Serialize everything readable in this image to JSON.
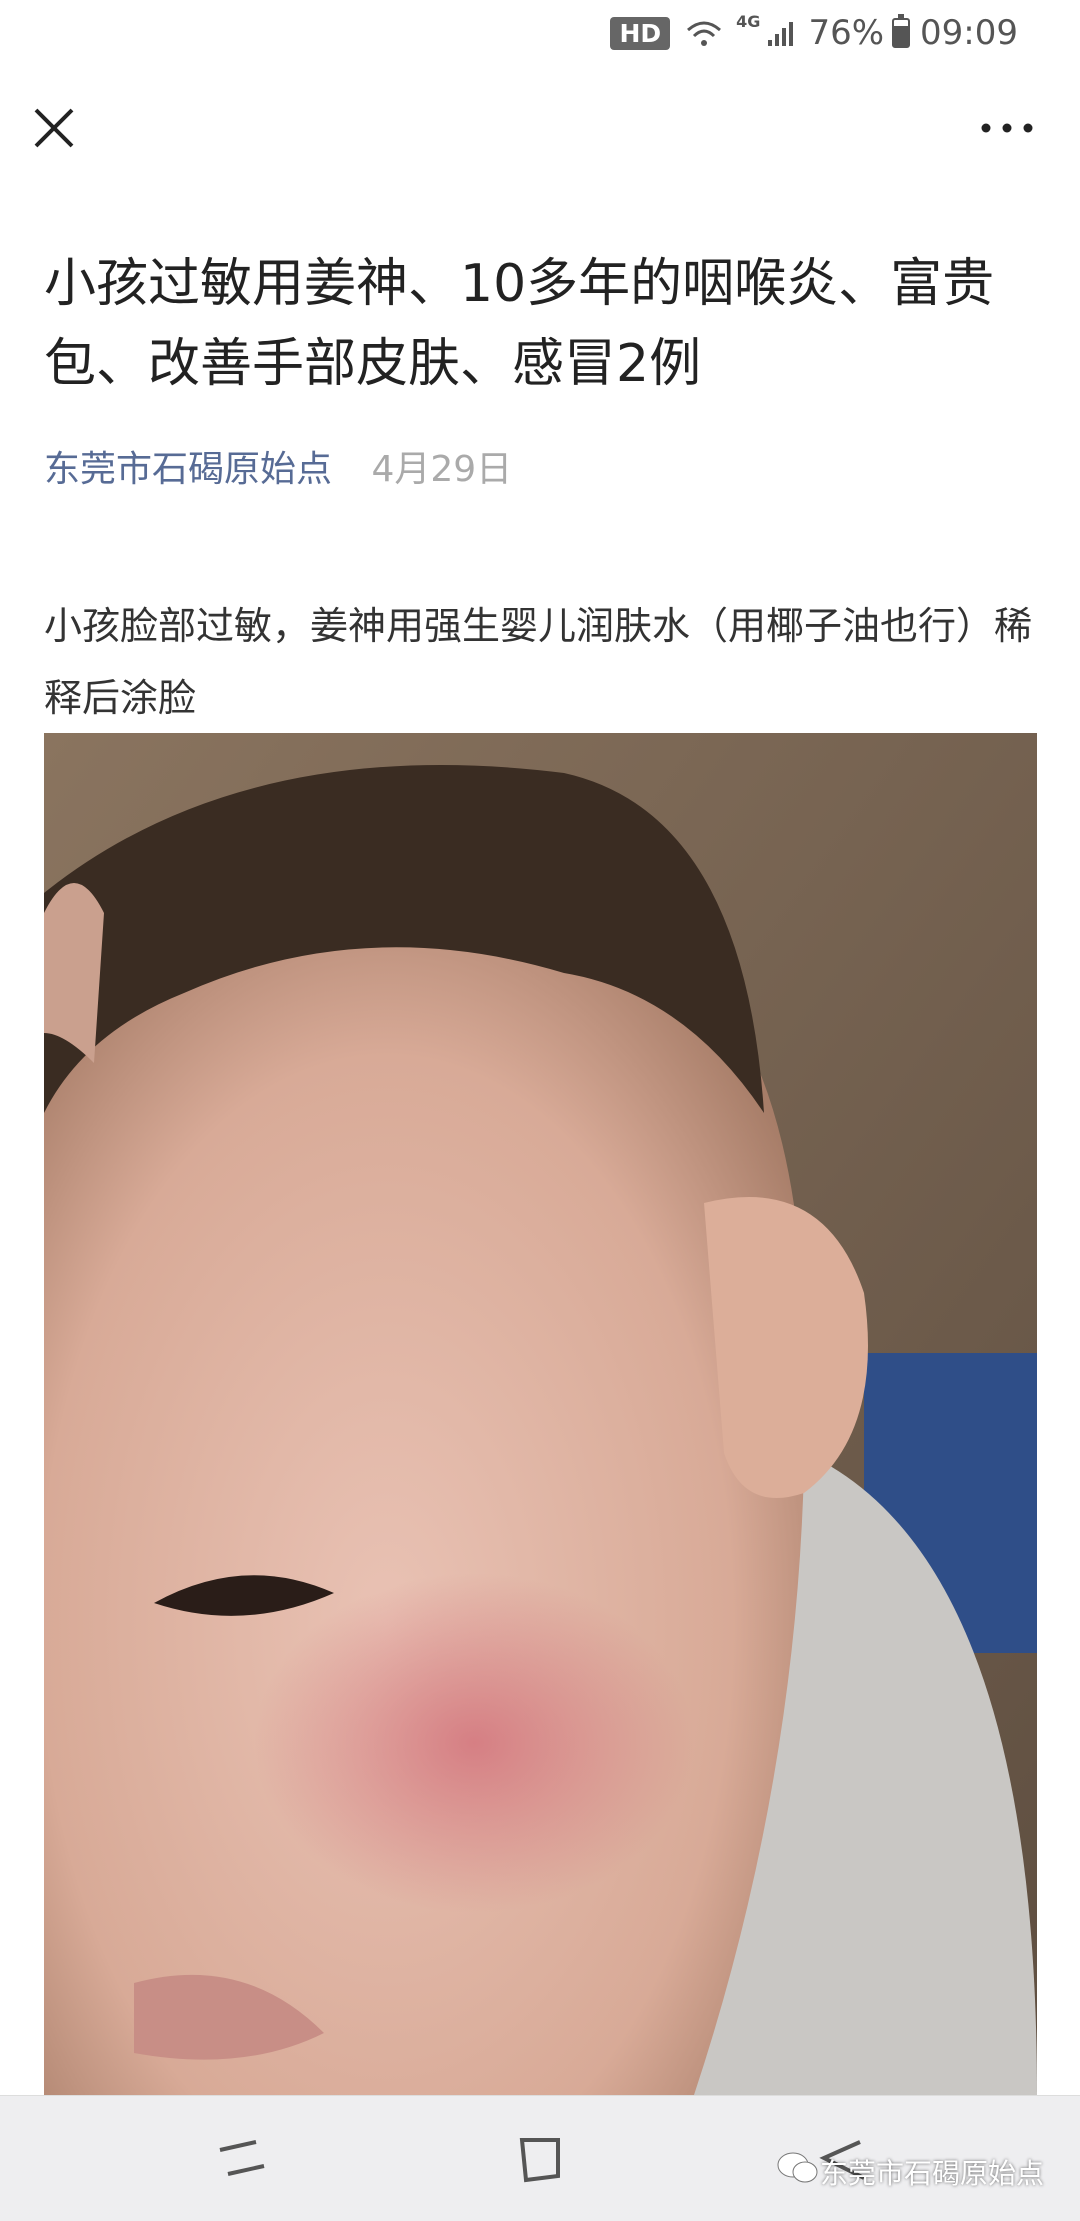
{
  "status_bar": {
    "hd": "HD",
    "network": "4G",
    "battery": "76%",
    "battery_level": 0.76,
    "time": "09:09"
  },
  "nav": {
    "close_icon": "close-icon",
    "more_icon": "more-icon"
  },
  "article": {
    "title": "小孩过敏用姜神、10多年的咽喉炎、富贵包、改善手部皮肤、感冒2例",
    "author": "东莞市石碣原始点",
    "date": "4月29日",
    "paragraph": "小孩脸部过敏，姜神用强生婴儿润肤水（用椰子油也行）稀释后涂脸"
  },
  "watermark": {
    "text": "东莞市石碣原始点",
    "icon": "wechat-icon"
  },
  "colors": {
    "author": "#576b95",
    "date": "#aaaaaa",
    "nav_bg": "#eeeef0"
  }
}
